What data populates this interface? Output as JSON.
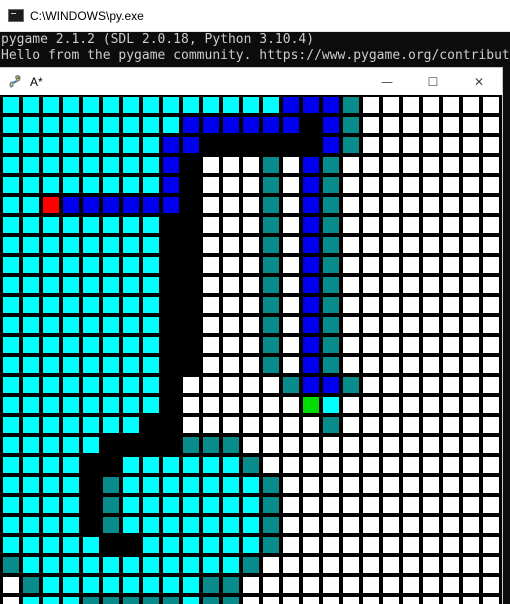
{
  "console": {
    "title": "C:\\WINDOWS\\py.exe",
    "lines": [
      "pygame 2.1.2 (SDL 2.0.18, Python 3.10.4)",
      "Hello from the pygame community. https://www.pygame.org/contribute"
    ]
  },
  "game_window": {
    "title": "A*",
    "minimize_symbol": "—",
    "maximize_symbol": "☐",
    "close_symbol": "✕"
  },
  "grid": {
    "colors": {
      "C": "#00ffff",
      "W": "#ffffff",
      "K": "#000000",
      "T": "#088b8b",
      "B": "#0000ee",
      "R": "#ff0000",
      "G": "#00dd00"
    },
    "rows": [
      "CCCCCCCCCCCCCCBBBTWWWWWWW",
      "CCCCCCCCCBBBBBBKBTWWWWWWW",
      "CCCCCCCCBBKKKKKKBTWWWWWWW",
      "CCCCCCCCBKWWWTWBTWWWWWWWW",
      "CCCCCCCCBKWWWTWBTWWWWWWWW",
      "CCRBBBBBBKWWWTWBTWWWWWWWW",
      "CCCCCCCCKKWWWTWBTWWWWWWWW",
      "CCCCCCCCKKWWWTWBTWWWWWWWW",
      "CCCCCCCCKKWWWTWBTWWWWWWWW",
      "CCCCCCCCKKWWWTWBTWWWWWWWW",
      "CCCCCCCCKKWWWTWBTWWWWWWWW",
      "CCCCCCCCKKWWWTWBTWWWWWWWW",
      "CCCCCCCCKKWWWTWBTWWWWWWWW",
      "CCCCCCCCKKWWWTWBTWWWWWWWW",
      "CCCCCCCCKWWWWWTBBTWWWWWWW",
      "CCCCCCCCKWWWWWWGCWWWWWWWW",
      "CCCCCCCKKWWWWWWWTWWWWWWWW",
      "CCCCCKKKKTTTWWWWWWWWWWWWW",
      "CCCCKKCCCCCCTWWWWWWWWWWWW",
      "CCCCKTCCCCCCCTWWWWWWWWWWW",
      "CCCCKTCCCCCCCTWWWWWWWWWWW",
      "CCCCKTCCCCCCCTWWWWWWWWWWW",
      "CCCCCKKCCCCCCTWWWWWWWWWWW",
      "TCCCCCCCCCCCTWWWWWWWWWWWW",
      "WTCCCCCCCCTTWWWWWWWWWWWWW",
      "WCCCTTTTTCTTWWWWWWWWWWWWW"
    ]
  }
}
